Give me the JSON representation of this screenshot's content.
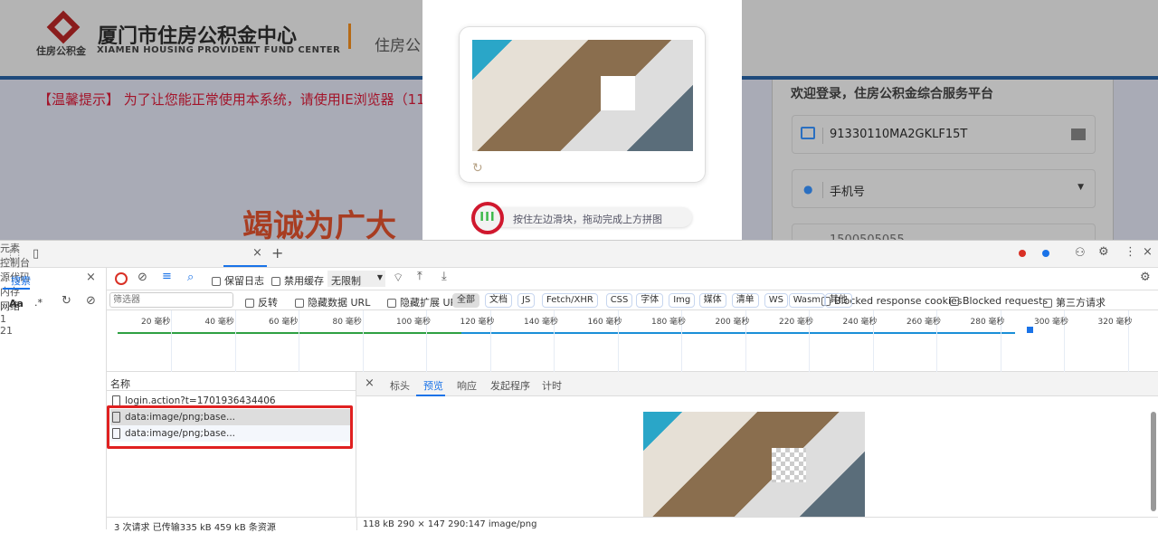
{
  "website": {
    "logo_text": "住房公积金",
    "title_cn": "厦门市住房公积金中心",
    "title_en": "XIAMEN HOUSING PROVIDENT FUND CENTER",
    "subtitle": "住房公",
    "notice": "【温馨提示】 为了让您能正常使用本系统，请使用IE浏览器（11",
    "slogan": "竭诚为广大",
    "login": {
      "heading": "欢迎登录，住房公积金综合服务平台",
      "account_value": "91330110MA2GKLF15T",
      "login_type": "手机号",
      "phone_partial": "1500505055"
    }
  },
  "captcha": {
    "slider_hint": "按住左边滑块，拖动完成上方拼图",
    "knob_label": "III"
  },
  "devtools": {
    "tabs": [
      "元素",
      "控制台",
      "源代码",
      "内存",
      "网络"
    ],
    "active_tab": "网络",
    "errors": "1",
    "messages": "21",
    "search_tab": "搜索",
    "search_opts": {
      "case": "Aa",
      "regex": ".*"
    },
    "toolbar": {
      "preserve_log": "保留日志",
      "disable_cache": "禁用缓存",
      "throttle": "无限制"
    },
    "filter": {
      "placeholder": "筛选器",
      "invert": "反转",
      "hide_data_url": "隐藏数据 URL",
      "hide_ext_url": "隐藏扩展 URL",
      "types": [
        "全部",
        "文档",
        "JS",
        "Fetch/XHR",
        "CSS",
        "字体",
        "Img",
        "媒体",
        "清单",
        "WS",
        "Wasm",
        "其他"
      ],
      "blocked_cookies": "Blocked response cookies",
      "blocked_requests": "Blocked requests",
      "third_party": "第三方请求"
    },
    "timeline_ticks": [
      "20 毫秒",
      "40 毫秒",
      "60 毫秒",
      "80 毫秒",
      "100 毫秒",
      "120 毫秒",
      "140 毫秒",
      "160 毫秒",
      "180 毫秒",
      "200 毫秒",
      "220 毫秒",
      "240 毫秒",
      "260 毫秒",
      "280 毫秒",
      "300 毫秒",
      "320 毫秒"
    ],
    "name_header": "名称",
    "requests": [
      "login.action?t=1701936434406",
      "data:image/png;base...",
      "data:image/png;base..."
    ],
    "detail_tabs": [
      "标头",
      "预览",
      "响应",
      "发起程序",
      "计时"
    ],
    "active_detail_tab": "预览",
    "status_left": "3 次请求  已传输335 kB  459 kB 条资源",
    "status_right": "118 kB  290 × 147  290:147  image/png"
  },
  "colors": {
    "accent": "#1a73e8",
    "highlight_box": "#e02020",
    "error": "#d93025"
  }
}
